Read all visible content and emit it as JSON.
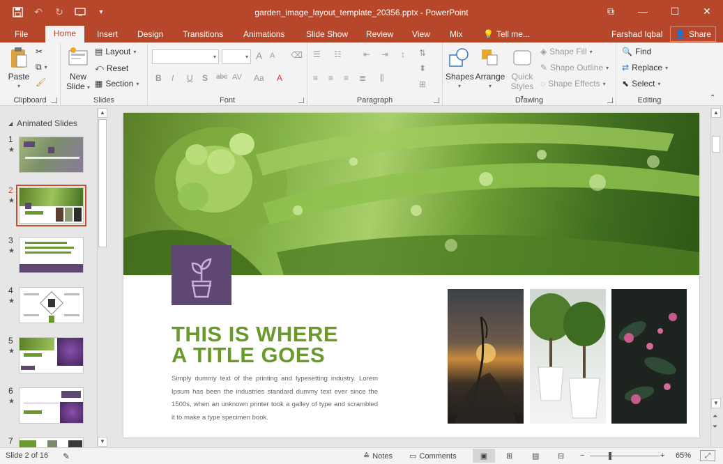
{
  "window": {
    "title": "garden_image_layout_template_20356.pptx - PowerPoint",
    "minimize": "—",
    "restore": "☐",
    "close": "✕",
    "ribbon_display": "⧉"
  },
  "tabs": [
    "File",
    "Home",
    "Insert",
    "Design",
    "Transitions",
    "Animations",
    "Slide Show",
    "Review",
    "View",
    "Mix",
    "Tell me..."
  ],
  "active_tab": "Home",
  "user": "Farshad Iqbal",
  "share_label": "Share",
  "ribbon": {
    "clipboard": {
      "label": "Clipboard",
      "paste": "Paste"
    },
    "slides": {
      "label": "Slides",
      "new_slide_1": "New",
      "new_slide_2": "Slide",
      "layout": "Layout",
      "reset": "Reset",
      "section": "Section"
    },
    "font": {
      "label": "Font",
      "font_name": "",
      "font_size": "",
      "bold": "B",
      "italic": "I",
      "underline": "U",
      "shadow": "S",
      "strike": "abc",
      "spacing": "AV",
      "case": "Aa",
      "grow": "A",
      "shrink": "A"
    },
    "paragraph": {
      "label": "Paragraph"
    },
    "drawing": {
      "label": "Drawing",
      "shapes": "Shapes",
      "arrange": "Arrange",
      "quick_1": "Quick",
      "quick_2": "Styles",
      "fill": "Shape Fill",
      "outline": "Shape Outline",
      "effects": "Shape Effects"
    },
    "editing": {
      "label": "Editing",
      "find": "Find",
      "replace": "Replace",
      "select": "Select"
    }
  },
  "side_panel": {
    "section_title": "Animated Slides",
    "thumbnails": [
      {
        "num": "1",
        "selected": false
      },
      {
        "num": "2",
        "selected": true
      },
      {
        "num": "3",
        "selected": false
      },
      {
        "num": "4",
        "selected": false
      },
      {
        "num": "5",
        "selected": false
      },
      {
        "num": "6",
        "selected": false
      },
      {
        "num": "7",
        "selected": false
      }
    ]
  },
  "slide": {
    "title_line1": "THIS IS WHERE",
    "title_line2": "A TITLE GOES",
    "body": "Simply dummy text of the printing and typesetting industry. Lorem Ipsum has been the industries standard dummy text ever since the 1500s, when an unknown printer took a galley of type and scrambled it to make a type specimen book.",
    "colors": {
      "title": "#6a9a2c",
      "icon_box": "#5e4871",
      "accent": "#b7472a"
    }
  },
  "status": {
    "slide_counter": "Slide 2 of 16",
    "notes": "Notes",
    "comments": "Comments",
    "zoom": "65%",
    "zoom_minus": "−",
    "zoom_plus": "+"
  }
}
